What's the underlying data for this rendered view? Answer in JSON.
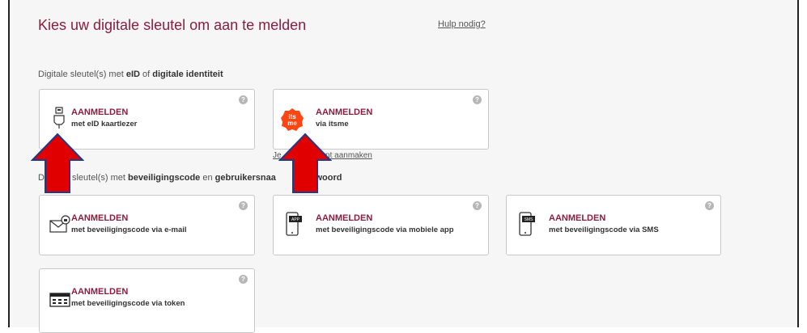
{
  "header": {
    "title": "Kies uw digitale sleutel om aan te melden",
    "help_link": "Hulp nodig?"
  },
  "section_eid": {
    "prefix": "Digitale sleutel(s) met ",
    "bold1": "eID",
    "mid": " of ",
    "bold2": "digitale identiteit"
  },
  "cards_eid": [
    {
      "title": "AANMELDEN",
      "subtitle": "met eID kaartlezer",
      "icon": "card-reader-icon"
    },
    {
      "title": "AANMELDEN",
      "subtitle": "via itsme",
      "icon": "itsme-icon",
      "link": "Je itsme account aanmaken"
    }
  ],
  "itsme_link_visible": "Je          account aanmaken",
  "section_code": {
    "prefix": "D",
    "text1": "sleutel(s) met ",
    "bold1": "beveiligingscode",
    "mid": " en ",
    "bold2": "gebruikersnaa",
    "tail": "achtwoord"
  },
  "cards_code": [
    {
      "title": "AANMELDEN",
      "subtitle": "met beveiligingscode via e-mail",
      "icon": "email-lock-icon"
    },
    {
      "title": "AANMELDEN",
      "subtitle": "met beveiligingscode via mobiele app",
      "icon": "mobile-app-icon",
      "badge": "APP"
    },
    {
      "title": "AANMELDEN",
      "subtitle": "met beveiligingscode via SMS",
      "icon": "sms-icon",
      "badge": "SMS"
    },
    {
      "title": "AANMELDEN",
      "subtitle": "met beveiligingscode via token",
      "icon": "token-icon"
    }
  ],
  "help_badge": "?",
  "colors": {
    "accent": "#8b1d3f",
    "arrow": "#e00000",
    "arrow_outline": "#1f3a8a",
    "itsme": "#ff4612"
  }
}
